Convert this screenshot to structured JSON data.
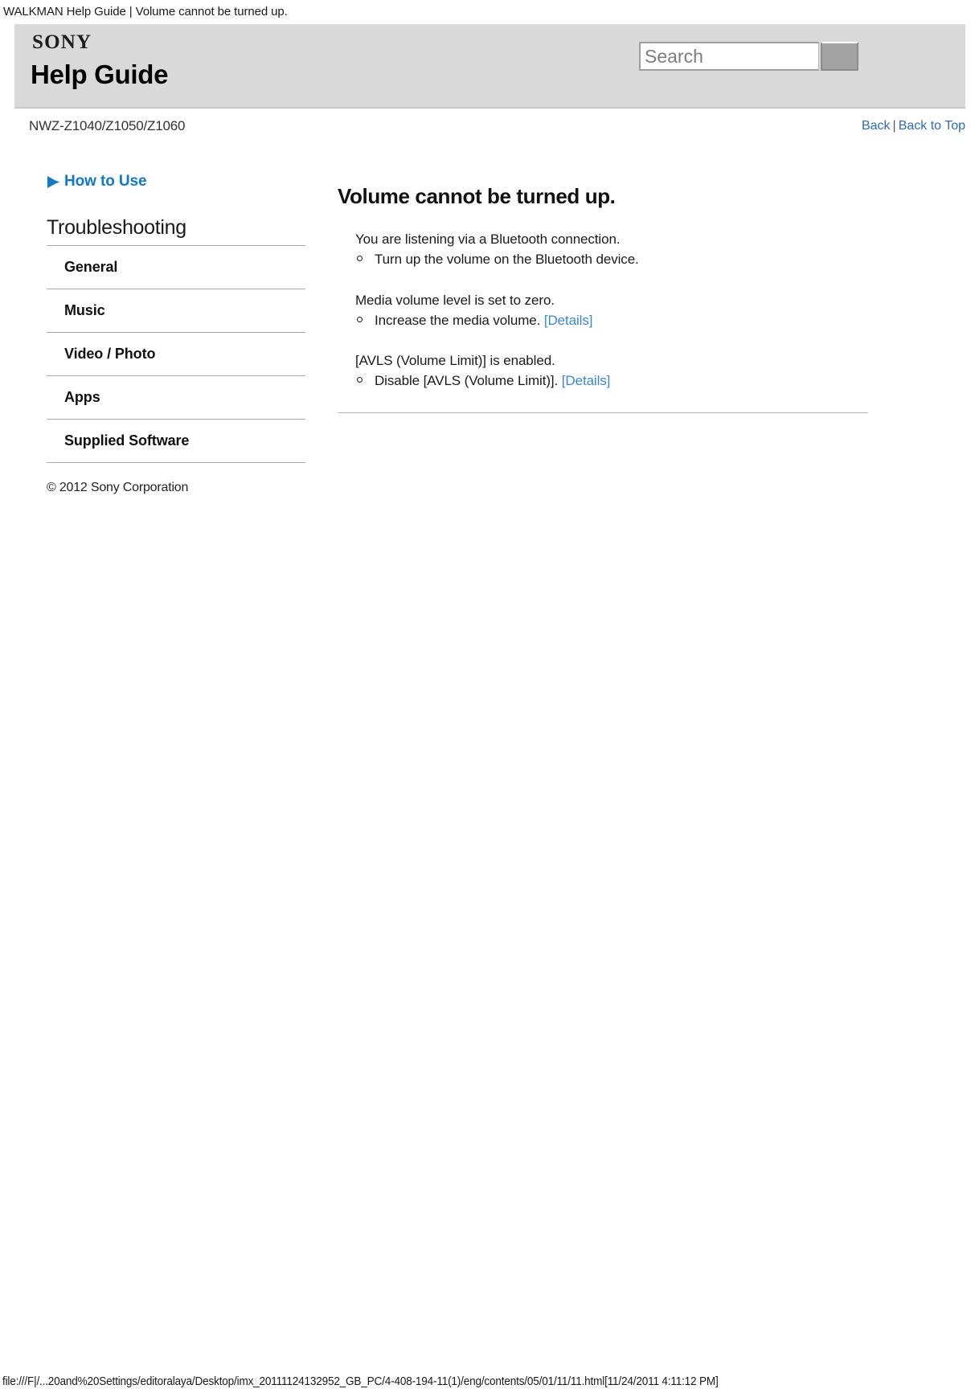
{
  "browser": {
    "print_header": "WALKMAN Help Guide | Volume cannot be turned up.",
    "file_path_footer": "file:///F|/...20and%20Settings/editoralaya/Desktop/imx_20111124132952_GB_PC/4-408-194-11(1)/eng/contents/05/01/11/11.html[11/24/2011 4:11:12 PM]"
  },
  "header": {
    "brand": "SONY",
    "title": "Help Guide",
    "search": {
      "placeholder": "Search",
      "value": "",
      "button_label": ""
    }
  },
  "subheader": {
    "model_number": "NWZ-Z1040/Z1050/Z1060",
    "back_label": "Back",
    "separator": "|",
    "back_to_top_label": "Back to Top"
  },
  "sidebar": {
    "how_to_use_label": "How to Use",
    "section_heading": "Troubleshooting",
    "items": [
      {
        "label": "General"
      },
      {
        "label": "Music"
      },
      {
        "label": "Video / Photo"
      },
      {
        "label": "Apps"
      },
      {
        "label": "Supplied Software"
      }
    ],
    "copyright": "© 2012 Sony Corporation"
  },
  "article": {
    "title": "Volume cannot be turned up.",
    "blocks": [
      {
        "cause": "You are listening via a Bluetooth connection.",
        "remedy_text": "Turn up the volume on the Bluetooth device.",
        "remedy_link": ""
      },
      {
        "cause": "Media volume level is set to zero.",
        "remedy_text": "Increase the media volume.",
        "remedy_link": "[Details]"
      },
      {
        "cause": "[AVLS (Volume Limit)] is enabled.",
        "remedy_text": "Disable [AVLS (Volume Limit)].",
        "remedy_link": "[Details]"
      }
    ]
  },
  "colors": {
    "banner_bg": "#d9d9d9",
    "link_blue": "#2a6ebb",
    "accent_blue": "#1278c8",
    "detail_link_blue": "#3a86d4"
  }
}
